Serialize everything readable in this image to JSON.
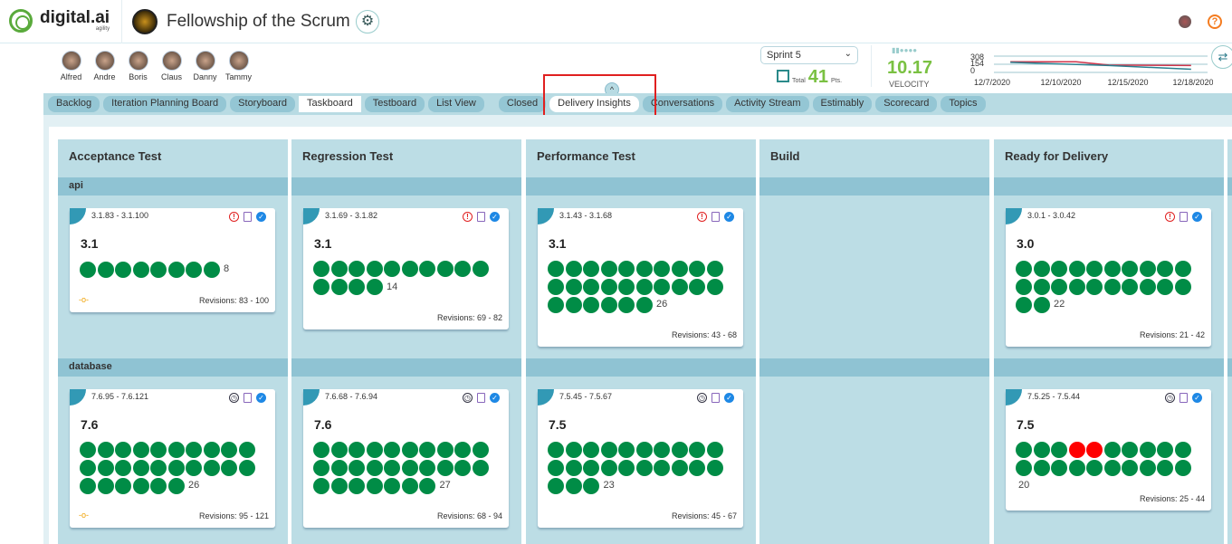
{
  "header": {
    "logo": "digital.ai",
    "logo_sub": "agility",
    "project_title": "Fellowship of the Scrum",
    "settings_icon": "gear-icon",
    "help_icon": "question-icon"
  },
  "team": [
    {
      "name": "Alfred"
    },
    {
      "name": "Andre"
    },
    {
      "name": "Boris"
    },
    {
      "name": "Claus"
    },
    {
      "name": "Danny"
    },
    {
      "name": "Tammy"
    }
  ],
  "sprint": {
    "selected": "Sprint 5",
    "total_label": "Total",
    "total": "41",
    "pts": "Pts."
  },
  "velocity": {
    "value": "10.17",
    "label": "VELOCITY"
  },
  "chart_data": {
    "type": "line",
    "y_ticks": [
      "308",
      "154",
      "0"
    ],
    "ylim": [
      0,
      308
    ],
    "x_labels": [
      "12/7/2020",
      "12/10/2020",
      "12/15/2020",
      "12/18/2020"
    ],
    "series": [
      {
        "color": "#d0334a",
        "values": [
          {
            "x": "12/7/2020",
            "y": 200
          },
          {
            "x": "12/11/2020",
            "y": 200
          },
          {
            "x": "12/13/2020",
            "y": 140
          },
          {
            "x": "12/18/2020",
            "y": 130
          }
        ]
      },
      {
        "color": "#2a7f8f",
        "values": [
          {
            "x": "12/7/2020",
            "y": 190
          },
          {
            "x": "12/13/2020",
            "y": 130
          },
          {
            "x": "12/18/2020",
            "y": 60
          }
        ]
      }
    ]
  },
  "tabs": [
    {
      "label": "Backlog"
    },
    {
      "label": "Iteration Planning Board"
    },
    {
      "label": "Storyboard"
    },
    {
      "label": "Taskboard",
      "active": true
    },
    {
      "label": "Testboard"
    },
    {
      "label": "List View"
    },
    {
      "label": "Closed",
      "group": true
    },
    {
      "label": "Delivery Insights",
      "highlighted": true
    },
    {
      "label": "Conversations"
    },
    {
      "label": "Activity Stream"
    },
    {
      "label": "Estimably"
    },
    {
      "label": "Scorecard"
    },
    {
      "label": "Topics"
    }
  ],
  "board": {
    "columns": [
      "Acceptance Test",
      "Regression Test",
      "Performance Test",
      "Build",
      "Ready for Delivery"
    ],
    "lanes": [
      {
        "name": "api",
        "cards": [
          {
            "range": "3.1.83 - 3.1.100",
            "version": "3.1",
            "count": 8,
            "red": [],
            "revisions": "Revisions: 83 - 100",
            "status": "alert",
            "commit": true
          },
          {
            "range": "3.1.69 - 3.1.82",
            "version": "3.1",
            "count": 14,
            "red": [],
            "revisions": "Revisions: 69 - 82",
            "status": "alert"
          },
          {
            "range": "3.1.43 - 3.1.68",
            "version": "3.1",
            "count": 26,
            "red": [],
            "revisions": "Revisions: 43 - 68",
            "status": "alert"
          },
          null,
          {
            "range": "3.0.1 - 3.0.42",
            "version": "3.0",
            "count": 22,
            "red": [],
            "revisions": "Revisions: 21 - 42",
            "status": "alert"
          }
        ]
      },
      {
        "name": "database",
        "cards": [
          {
            "range": "7.6.95 - 7.6.121",
            "version": "7.6",
            "count": 26,
            "red": [],
            "revisions": "Revisions: 95 - 121",
            "status": "clock",
            "commit": true
          },
          {
            "range": "7.6.68 - 7.6.94",
            "version": "7.6",
            "count": 27,
            "red": [],
            "revisions": "Revisions: 68 - 94",
            "status": "clock"
          },
          {
            "range": "7.5.45 - 7.5.67",
            "version": "7.5",
            "count": 23,
            "red": [],
            "revisions": "Revisions: 45 - 67",
            "status": "clock"
          },
          null,
          {
            "range": "7.5.25 - 7.5.44",
            "version": "7.5",
            "count": 20,
            "red": [
              4,
              5
            ],
            "revisions": "Revisions: 25 - 44",
            "status": "clock"
          }
        ]
      }
    ]
  }
}
